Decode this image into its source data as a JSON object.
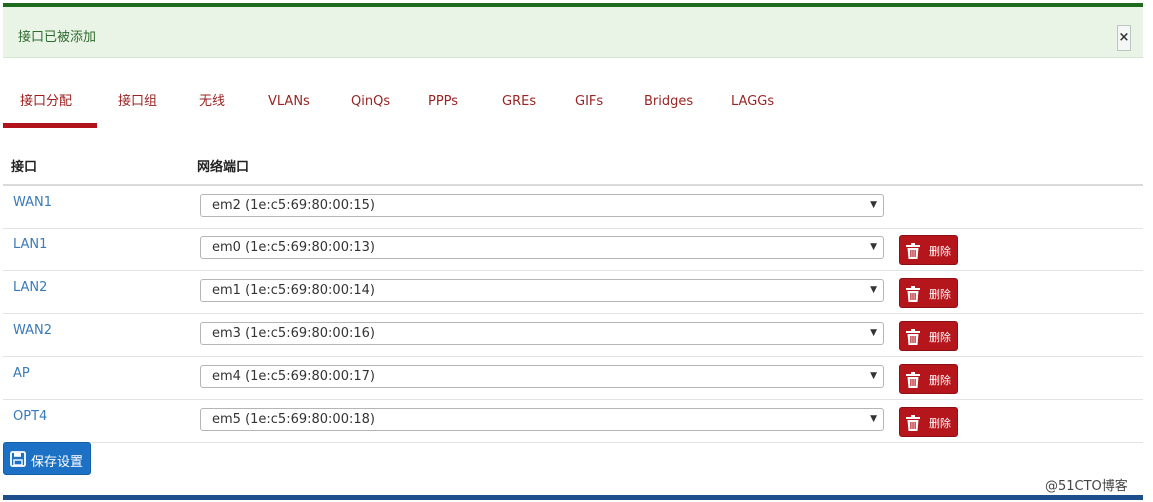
{
  "alert": {
    "text": "接口已被添加",
    "close_label": "×"
  },
  "tabs": [
    {
      "label": "接口分配",
      "active": true
    },
    {
      "label": "接口组"
    },
    {
      "label": "无线"
    },
    {
      "label": "VLANs"
    },
    {
      "label": "QinQs"
    },
    {
      "label": "PPPs"
    },
    {
      "label": "GREs"
    },
    {
      "label": "GIFs"
    },
    {
      "label": "Bridges"
    },
    {
      "label": "LAGGs"
    }
  ],
  "table": {
    "headers": {
      "interface": "接口",
      "port": "网络端口"
    },
    "rows": [
      {
        "name": "WAN1",
        "port": "em2 (1e:c5:69:80:00:15)",
        "deletable": false
      },
      {
        "name": "LAN1",
        "port": "em0 (1e:c5:69:80:00:13)",
        "deletable": true
      },
      {
        "name": "LAN2",
        "port": "em1 (1e:c5:69:80:00:14)",
        "deletable": true
      },
      {
        "name": "WAN2",
        "port": "em3 (1e:c5:69:80:00:16)",
        "deletable": true
      },
      {
        "name": "AP",
        "port": "em4 (1e:c5:69:80:00:17)",
        "deletable": true
      },
      {
        "name": "OPT4",
        "port": "em5 (1e:c5:69:80:00:18)",
        "deletable": true
      }
    ],
    "delete_label": "删除"
  },
  "save_label": "保存设置",
  "watermark": "@51CTO博客",
  "colors": {
    "accent_red": "#b5161c",
    "primary_blue": "#1c71c4",
    "link_blue": "#3a7ab8",
    "success_green": "#1e6a1e"
  }
}
